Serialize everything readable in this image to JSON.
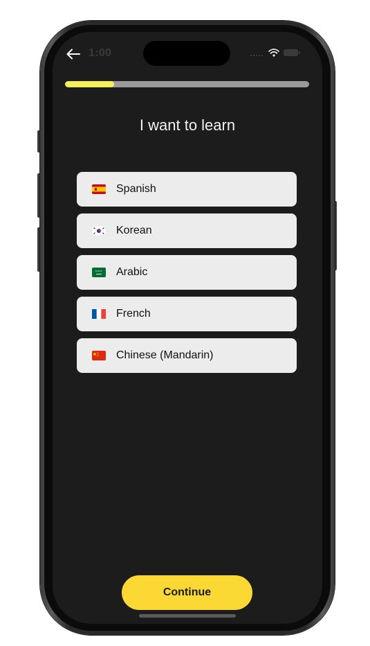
{
  "status_bar": {
    "time": "1:00"
  },
  "progress": {
    "fraction": 0.2,
    "fill_color": "#f6ef5a",
    "track_color": "#9a9a9a"
  },
  "header": {
    "back_icon": "arrow-left-icon",
    "title": "I want to learn"
  },
  "languages": [
    {
      "label": "Spanish",
      "flag": "spain-flag-icon"
    },
    {
      "label": "Korean",
      "flag": "korea-flag-icon"
    },
    {
      "label": "Arabic",
      "flag": "saudi-arabia-flag-icon"
    },
    {
      "label": "French",
      "flag": "france-flag-icon"
    },
    {
      "label": "Chinese (Mandarin)",
      "flag": "china-flag-icon"
    }
  ],
  "footer": {
    "continue_label": "Continue",
    "accent_color": "#fbd833"
  }
}
